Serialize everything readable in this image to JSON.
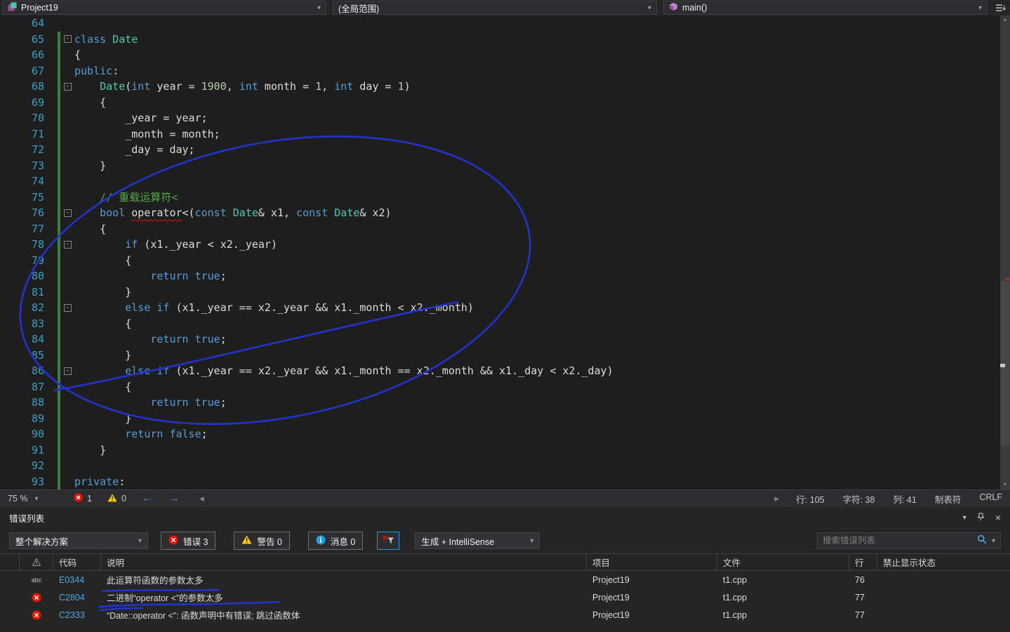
{
  "icons": {
    "chevron_down": "▾",
    "back_arrow": "←",
    "forward_arrow": "→",
    "scroll_left": "◀",
    "scroll_right": "▶",
    "scroll_up": "▲",
    "scroll_down": "▼",
    "close": "×",
    "fold_collapse": "-"
  },
  "colors": {
    "pen_blue": "#2233CB",
    "error_red": "#E51400",
    "warning_yellow": "#FFCC00",
    "info_blue": "#1BA1E2",
    "keyword_blue": "#569CD6",
    "type_teal": "#4EC9B0",
    "comment_green": "#57A64A"
  },
  "topbar": {
    "project": "Project19",
    "scope": "(全局范围)",
    "member": "main()"
  },
  "editor": {
    "lines": [
      {
        "n": 64,
        "t": []
      },
      {
        "n": 65,
        "ch": true,
        "fold": true,
        "t": [
          [
            "k",
            "class"
          ],
          [
            "p",
            " "
          ],
          [
            "t",
            "Date"
          ]
        ]
      },
      {
        "n": 66,
        "ch": true,
        "t": [
          [
            "p",
            "{"
          ]
        ]
      },
      {
        "n": 67,
        "ch": true,
        "t": [
          [
            "k",
            "public"
          ],
          [
            "p",
            ":"
          ]
        ]
      },
      {
        "n": 68,
        "ch": true,
        "fold": true,
        "t": [
          [
            "p",
            "    "
          ],
          [
            "t",
            "Date"
          ],
          [
            "p",
            "("
          ],
          [
            "k",
            "int"
          ],
          [
            "p",
            " year = "
          ],
          [
            "n",
            "1900"
          ],
          [
            "p",
            ", "
          ],
          [
            "k",
            "int"
          ],
          [
            "p",
            " month = "
          ],
          [
            "n",
            "1"
          ],
          [
            "p",
            ", "
          ],
          [
            "k",
            "int"
          ],
          [
            "p",
            " day = "
          ],
          [
            "n",
            "1"
          ],
          [
            "p",
            ")"
          ]
        ]
      },
      {
        "n": 69,
        "ch": true,
        "t": [
          [
            "p",
            "    {"
          ]
        ]
      },
      {
        "n": 70,
        "ch": true,
        "t": [
          [
            "p",
            "        _year = year;"
          ]
        ]
      },
      {
        "n": 71,
        "ch": true,
        "t": [
          [
            "p",
            "        _month = month;"
          ]
        ]
      },
      {
        "n": 72,
        "ch": true,
        "t": [
          [
            "p",
            "        _day = day;"
          ]
        ]
      },
      {
        "n": 73,
        "ch": true,
        "t": [
          [
            "p",
            "    }"
          ]
        ]
      },
      {
        "n": 74,
        "ch": true,
        "t": []
      },
      {
        "n": 75,
        "ch": true,
        "t": [
          [
            "p",
            "    "
          ],
          [
            "c",
            "// 重载运算符<"
          ]
        ]
      },
      {
        "n": 76,
        "ch": true,
        "fold": true,
        "t": [
          [
            "p",
            "    "
          ],
          [
            "k",
            "bool"
          ],
          [
            "p",
            " "
          ],
          [
            "e",
            "operator"
          ],
          [
            "p",
            "<("
          ],
          [
            "k",
            "const"
          ],
          [
            "p",
            " "
          ],
          [
            "t",
            "Date"
          ],
          [
            "p",
            "& x1, "
          ],
          [
            "k",
            "const"
          ],
          [
            "p",
            " "
          ],
          [
            "t",
            "Date"
          ],
          [
            "p",
            "& x2)"
          ]
        ]
      },
      {
        "n": 77,
        "ch": true,
        "t": [
          [
            "p",
            "    {"
          ]
        ]
      },
      {
        "n": 78,
        "ch": true,
        "fold": true,
        "t": [
          [
            "p",
            "        "
          ],
          [
            "k",
            "if"
          ],
          [
            "p",
            " (x1._year < x2._year)"
          ]
        ]
      },
      {
        "n": 79,
        "ch": true,
        "t": [
          [
            "p",
            "        {"
          ]
        ]
      },
      {
        "n": 80,
        "ch": true,
        "t": [
          [
            "p",
            "            "
          ],
          [
            "k",
            "return"
          ],
          [
            "p",
            " "
          ],
          [
            "k",
            "true"
          ],
          [
            "p",
            ";"
          ]
        ]
      },
      {
        "n": 81,
        "ch": true,
        "t": [
          [
            "p",
            "        }"
          ]
        ]
      },
      {
        "n": 82,
        "ch": true,
        "fold": true,
        "t": [
          [
            "p",
            "        "
          ],
          [
            "k",
            "else"
          ],
          [
            "p",
            " "
          ],
          [
            "k",
            "if"
          ],
          [
            "p",
            " (x1._year == x2._year && x1._month < x2._month)"
          ]
        ]
      },
      {
        "n": 83,
        "ch": true,
        "t": [
          [
            "p",
            "        {"
          ]
        ]
      },
      {
        "n": 84,
        "ch": true,
        "t": [
          [
            "p",
            "            "
          ],
          [
            "k",
            "return"
          ],
          [
            "p",
            " "
          ],
          [
            "k",
            "true"
          ],
          [
            "p",
            ";"
          ]
        ]
      },
      {
        "n": 85,
        "ch": true,
        "t": [
          [
            "p",
            "        }"
          ]
        ]
      },
      {
        "n": 86,
        "ch": true,
        "fold": true,
        "t": [
          [
            "p",
            "        "
          ],
          [
            "k",
            "else"
          ],
          [
            "p",
            " "
          ],
          [
            "k",
            "if"
          ],
          [
            "p",
            " (x1._year == x2._year && x1._month == x2._month && x1._day < x2._day)"
          ]
        ]
      },
      {
        "n": 87,
        "ch": true,
        "t": [
          [
            "p",
            "        {"
          ]
        ]
      },
      {
        "n": 88,
        "ch": true,
        "t": [
          [
            "p",
            "            "
          ],
          [
            "k",
            "return"
          ],
          [
            "p",
            " "
          ],
          [
            "k",
            "true"
          ],
          [
            "p",
            ";"
          ]
        ]
      },
      {
        "n": 89,
        "ch": true,
        "t": [
          [
            "p",
            "        }"
          ]
        ]
      },
      {
        "n": 90,
        "ch": true,
        "t": [
          [
            "p",
            "        "
          ],
          [
            "k",
            "return"
          ],
          [
            "p",
            " "
          ],
          [
            "k",
            "false"
          ],
          [
            "p",
            ";"
          ]
        ]
      },
      {
        "n": 91,
        "ch": true,
        "t": [
          [
            "p",
            "    }"
          ]
        ]
      },
      {
        "n": 92,
        "ch": true,
        "t": []
      },
      {
        "n": 93,
        "ch": true,
        "t": [
          [
            "k",
            "private"
          ],
          [
            "p",
            ":"
          ]
        ]
      }
    ]
  },
  "statusbar": {
    "zoom": "75 %",
    "error_count": "1",
    "warning_count": "0",
    "line": "行: 105",
    "char": "字符: 38",
    "col": "列: 41",
    "tabs": "制表符",
    "eol": "CRLF"
  },
  "errorlist": {
    "title": "错误列表",
    "scope_filter": "整个解决方案",
    "errors_toggle": "错误 3",
    "warnings_toggle": "警告 0",
    "messages_toggle": "消息 0",
    "source_filter": "生成 + IntelliSense",
    "search_placeholder": "搜索错误列表",
    "columns": [
      "代码",
      "说明",
      "项目",
      "文件",
      "行",
      "禁止显示状态"
    ],
    "rows": [
      {
        "severity": "intellisense-error",
        "badge": "abc",
        "code": "E0344",
        "description": "此运算符函数的参数太多",
        "project": "Project19",
        "file": "t1.cpp",
        "line": "76"
      },
      {
        "severity": "error",
        "code": "C2804",
        "description": "二进制“operator <”的参数太多",
        "project": "Project19",
        "file": "t1.cpp",
        "line": "77"
      },
      {
        "severity": "error",
        "code": "C2333",
        "description": "“Date::operator <”: 函数声明中有错误; 跳过函数体",
        "project": "Project19",
        "file": "t1.cpp",
        "line": "77"
      }
    ]
  }
}
